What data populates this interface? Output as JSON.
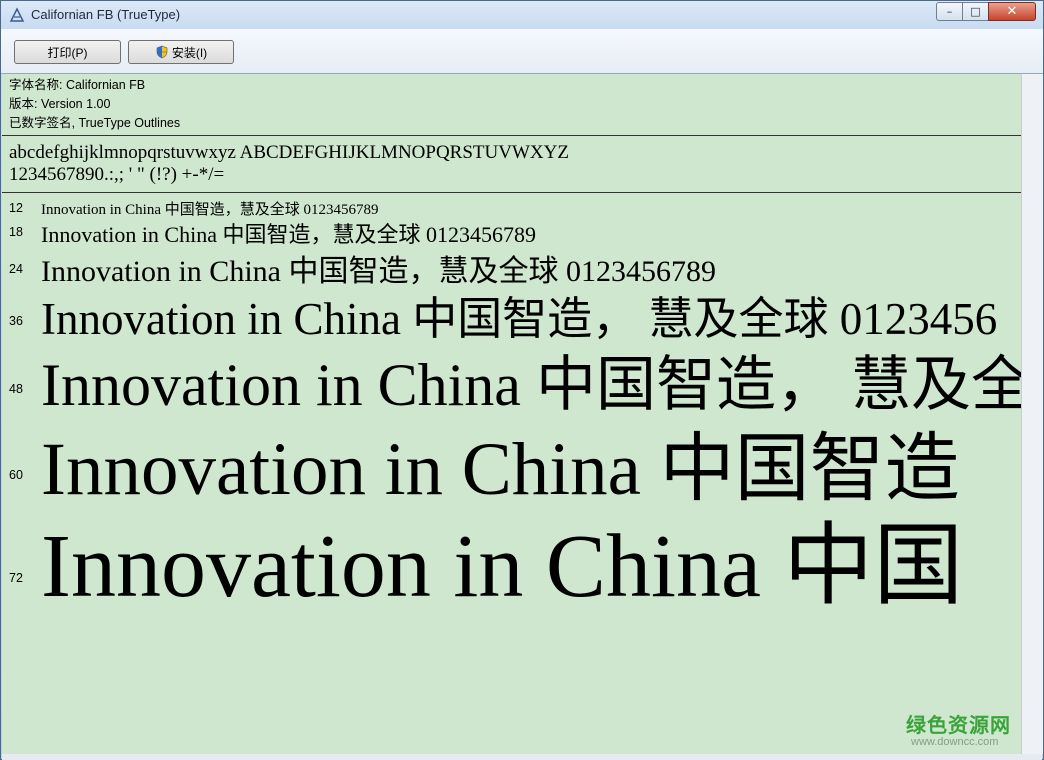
{
  "window": {
    "title": "Californian FB (TrueType)",
    "minimize_glyph": "–",
    "maximize_glyph": "□",
    "close_glyph": "✕"
  },
  "toolbar": {
    "print_label": "打印(P)",
    "install_label": "安装(I)"
  },
  "font_info": {
    "name": "字体名称: Californian FB",
    "version": "版本: Version 1.00",
    "signature": "已数字签名, TrueType Outlines"
  },
  "charset": {
    "letters": "abcdefghijklmnopqrstuvwxyz ABCDEFGHIJKLMNOPQRSTUVWXYZ",
    "digits": "1234567890.:,; ' \" (!?) +-*/="
  },
  "samples": [
    {
      "size": "12",
      "text": "Innovation in China 中国智造，慧及全球 0123456789"
    },
    {
      "size": "18",
      "text": "Innovation in China 中国智造，慧及全球 0123456789"
    },
    {
      "size": "24",
      "text": "Innovation in China 中国智造，慧及全球 0123456789"
    },
    {
      "size": "36",
      "text": "Innovation in China 中国智造， 慧及全球 0123456"
    },
    {
      "size": "48",
      "text": "Innovation in China 中国智造， 慧及全"
    },
    {
      "size": "60",
      "text": "Innovation in China 中国智造"
    },
    {
      "size": "72",
      "text": "Innovation in China 中国"
    }
  ],
  "watermark": {
    "brand": "绿色资源网",
    "url": "www.downcc.com"
  },
  "colors": {
    "content_bg": "#cfe6cf",
    "watermark": "#3aa43a"
  }
}
